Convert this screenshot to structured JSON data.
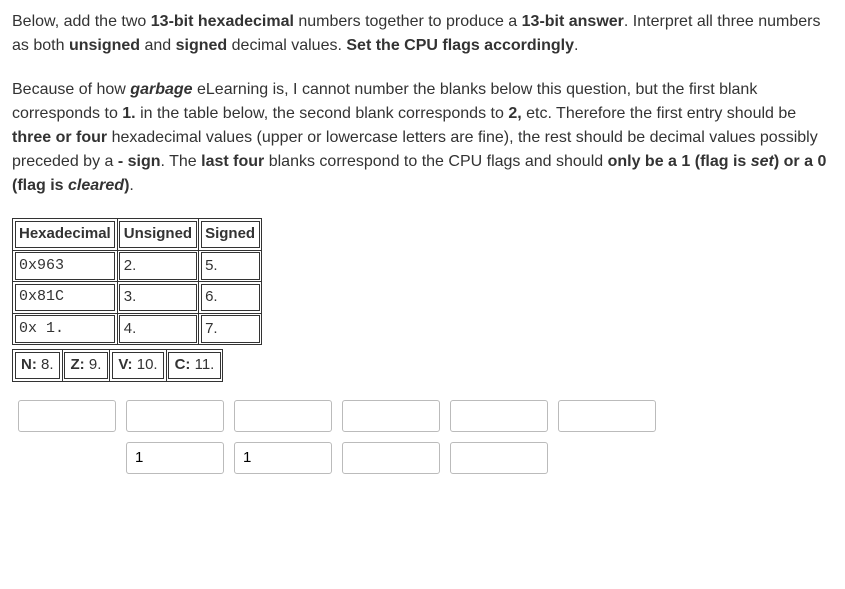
{
  "intro": {
    "text_parts": [
      "Below, add the two ",
      "13-bit hexadecimal",
      " numbers together to produce a ",
      "13-bit answer",
      ". Interpret all three numbers as both ",
      "unsigned",
      " and ",
      "signed",
      " decimal values. ",
      "Set the CPU flags accordingly",
      "."
    ]
  },
  "explanation": {
    "p1": "Because of how ",
    "garbage": "garbage",
    "p2": " eLearning is, I cannot number the blanks below this question, but the first blank corresponds to ",
    "b1": "1.",
    "p3": " in the table below, the second blank corresponds to ",
    "b2": "2,",
    "p4": " etc. Therefore the first entry should be ",
    "b3": "three or four",
    "p5": " hexadecimal values (upper or lowercase letters are fine), the rest should be decimal values possibly preceded by a ",
    "b4": "- sign",
    "p6": ". The ",
    "b5": "last four",
    "p7": " blanks correspond to the CPU flags and should ",
    "b6": "only be a 1 (flag is ",
    "i1": "set",
    "b7": ") or a 0 (flag is ",
    "i2": "cleared",
    "b8": ")",
    "p8": "."
  },
  "table": {
    "headers": [
      "Hexadecimal",
      "Unsigned",
      "Signed"
    ],
    "rows": [
      {
        "hex": "0x963",
        "unsigned": "2.",
        "signed": "5."
      },
      {
        "hex": "0x81C",
        "unsigned": "3.",
        "signed": "6."
      },
      {
        "hex": "0x 1.",
        "unsigned": "4.",
        "signed": "7."
      }
    ]
  },
  "flags": {
    "n": {
      "label": "N:",
      "val": "8."
    },
    "z": {
      "label": "Z:",
      "val": "9."
    },
    "v": {
      "label": "V:",
      "val": "10."
    },
    "c": {
      "label": "C:",
      "val": "11."
    }
  },
  "inputs": {
    "row1": [
      "",
      "",
      "",
      "",
      "",
      ""
    ],
    "row2": [
      "1",
      "1",
      "",
      ""
    ]
  }
}
